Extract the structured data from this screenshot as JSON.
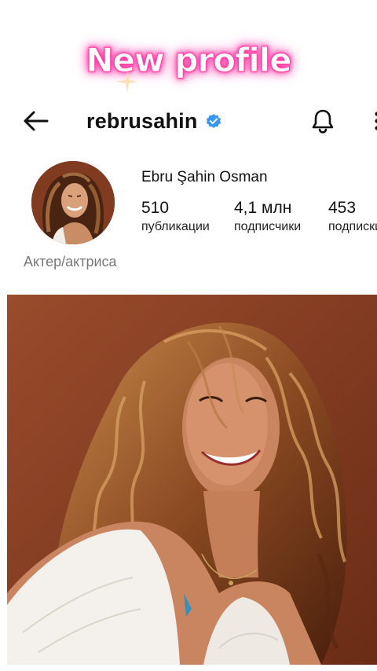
{
  "banner": {
    "text": "New profile"
  },
  "header": {
    "username": "rebrusahin",
    "icons": {
      "back": "arrow-left-icon",
      "verified": "verified-badge-icon",
      "bell": "bell-icon",
      "more": "more-vertical-icon"
    }
  },
  "profile": {
    "full_name": "Ebru Şahin Osman",
    "bio": "Актер/актриса",
    "stats": [
      {
        "value": "510",
        "label": "публикации"
      },
      {
        "value": "4,1 млн",
        "label": "подписчики"
      },
      {
        "value": "453",
        "label": "подписки"
      }
    ]
  },
  "colors": {
    "banner_glow": "#ff2e9a",
    "verified_blue": "#3897f0",
    "photo_background": "#8a3f23"
  }
}
